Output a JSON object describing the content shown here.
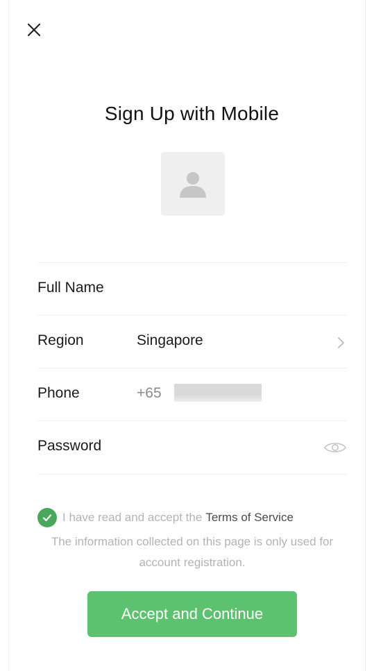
{
  "header": {
    "close_icon": "close-icon",
    "title": "Sign Up with Mobile"
  },
  "avatar": {
    "icon": "person-silhouette-icon"
  },
  "form": {
    "full_name": {
      "label": "Full Name",
      "value": ""
    },
    "region": {
      "label": "Region",
      "value": "Singapore",
      "icon": "chevron-right-icon"
    },
    "phone": {
      "label": "Phone",
      "country_code": "+65",
      "number_redacted": true
    },
    "password": {
      "label": "Password",
      "value": "",
      "icon": "eye-icon"
    }
  },
  "agreement": {
    "checked": true,
    "text": "I have read and accept the",
    "link": "Terms of Service",
    "info": "The information collected on this page is only used for account registration."
  },
  "actions": {
    "accept_label": "Accept and Continue"
  },
  "colors": {
    "accent_green": "#5cc26f",
    "check_green": "#4aa85a",
    "muted_text": "#b3b3b3"
  }
}
